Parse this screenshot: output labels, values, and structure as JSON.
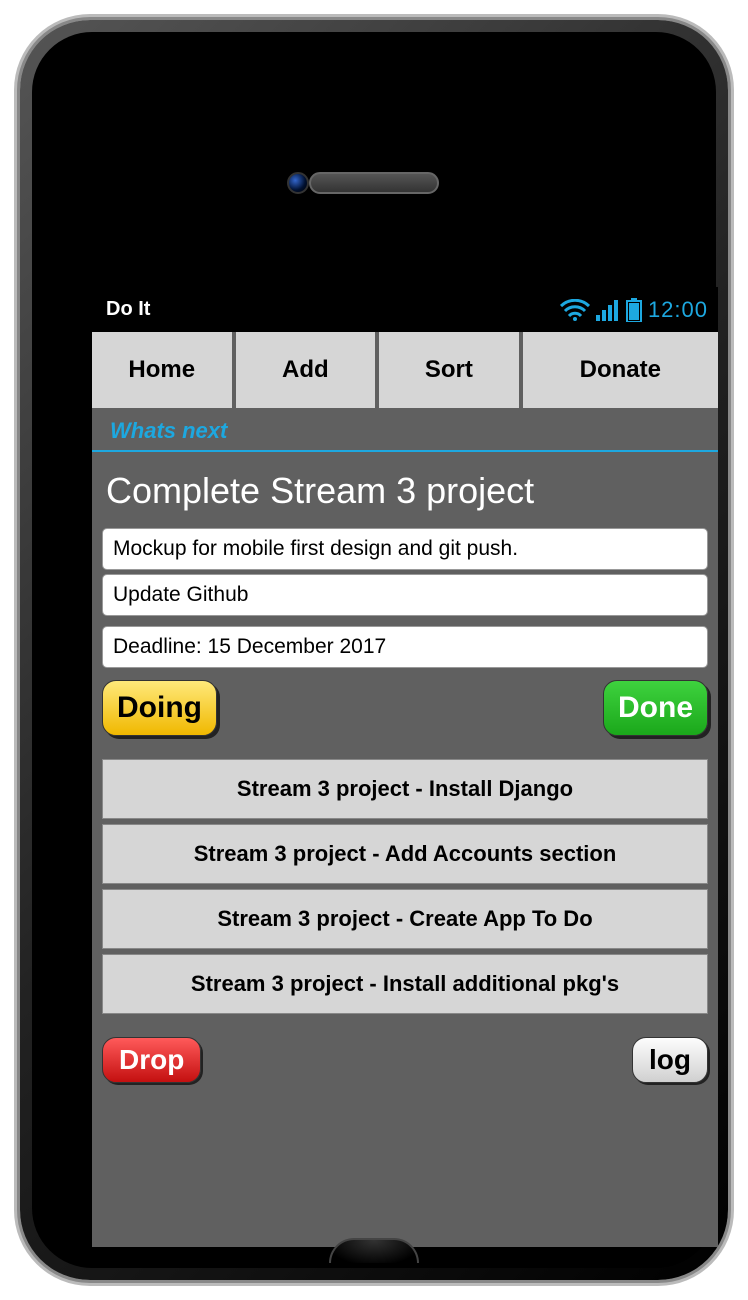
{
  "statusbar": {
    "app_name": "Do It",
    "time": "12:00"
  },
  "nav": {
    "items": [
      "Home",
      "Add",
      "Sort",
      "Donate"
    ]
  },
  "section_header": "Whats next",
  "task": {
    "title": "Complete Stream 3 project",
    "notes": [
      "Mockup for mobile first design and git push.",
      "Update Github"
    ],
    "deadline_label": "Deadline: 15 December 2017",
    "doing_label": "Doing",
    "done_label": "Done"
  },
  "backlog": [
    "Stream 3 project - Install Django",
    "Stream 3 project - Add Accounts section",
    "Stream 3 project - Create App To Do",
    "Stream 3 project - Install additional pkg's"
  ],
  "footer": {
    "drop_label": "Drop",
    "log_label": "log"
  }
}
